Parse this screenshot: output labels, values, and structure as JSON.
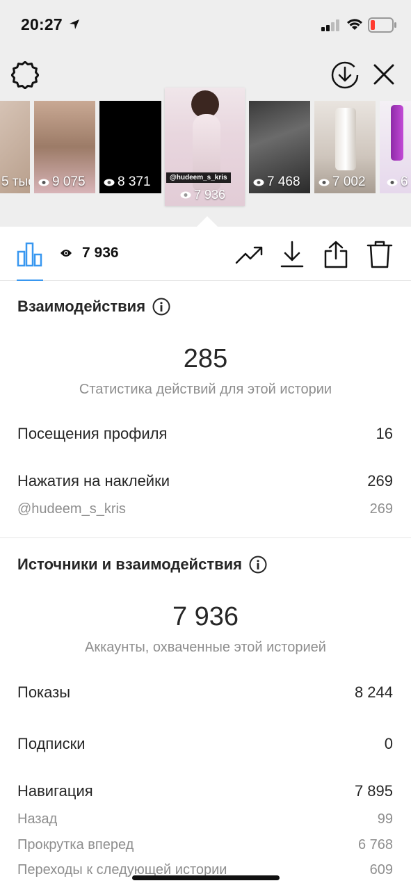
{
  "status_bar": {
    "time": "20:27"
  },
  "stories": [
    {
      "views": "5 тыс"
    },
    {
      "views": "9 075"
    },
    {
      "views": "8 371"
    },
    {
      "views": "7 936",
      "handle": "@hudeem_s_kris",
      "selected": true
    },
    {
      "views": "7 468"
    },
    {
      "views": "7 002"
    },
    {
      "views": "6"
    }
  ],
  "toolbar": {
    "views_count": "7 936"
  },
  "interactions": {
    "title": "Взаимодействия",
    "total": "285",
    "caption": "Статистика действий для этой истории",
    "rows": [
      {
        "label": "Посещения профиля",
        "value": "16"
      },
      {
        "label": "Нажатия на наклейки",
        "value": "269"
      }
    ],
    "sub_rows": [
      {
        "label": "@hudeem_s_kris",
        "value": "269"
      }
    ]
  },
  "discovery": {
    "title": "Источники и взаимодействия",
    "total": "7 936",
    "caption": "Аккаунты, охваченные этой историей",
    "rows": [
      {
        "label": "Показы",
        "value": "8 244"
      },
      {
        "label": "Подписки",
        "value": "0"
      },
      {
        "label": "Навигация",
        "value": "7 895"
      }
    ],
    "nav_sub_rows": [
      {
        "label": "Назад",
        "value": "99"
      },
      {
        "label": "Прокрутка вперед",
        "value": "6 768"
      },
      {
        "label": "Переходы к следующей истории",
        "value": "609"
      }
    ]
  },
  "colors": {
    "accent": "#3897f0",
    "text": "#262626",
    "muted": "#8e8e8e",
    "top_bg": "#eeeeee"
  }
}
